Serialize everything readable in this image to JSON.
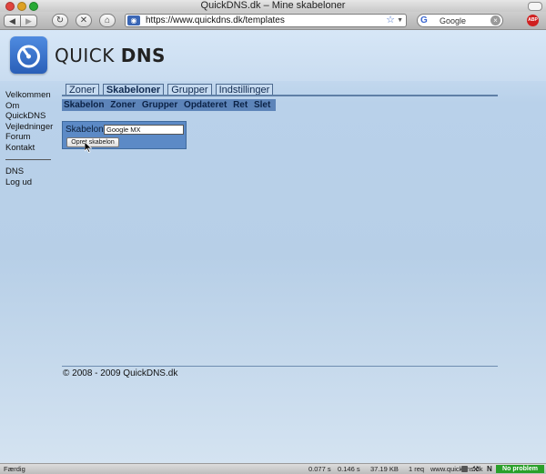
{
  "window": {
    "title": "QuickDNS.dk – Mine skabeloner"
  },
  "toolbar": {
    "back_glyph": "◀",
    "forward_glyph": "▶",
    "reload_glyph": "↻",
    "stop_glyph": "✕",
    "home_glyph": "⌂",
    "url": "https://www.quickdns.dk/templates",
    "search_placeholder": "Google",
    "search_value": "Google",
    "adblock_label": "ABP"
  },
  "header": {
    "logo_text_light": "QUICK",
    "logo_text_bold": "DNS"
  },
  "sidebar": {
    "items": [
      {
        "label": "Velkommen"
      },
      {
        "label": "Om QuickDNS"
      },
      {
        "label": "Vejledninger"
      },
      {
        "label": "Forum"
      },
      {
        "label": "Kontakt"
      }
    ],
    "items2": [
      {
        "label": "DNS"
      },
      {
        "label": "Log ud"
      }
    ]
  },
  "tabs": [
    {
      "label": "Zoner",
      "active": false
    },
    {
      "label": "Skabeloner",
      "active": true
    },
    {
      "label": "Grupper",
      "active": false
    },
    {
      "label": "Indstillinger",
      "active": false
    }
  ],
  "columns": [
    "Skabelon",
    "Zoner",
    "Grupper",
    "Opdateret",
    "Ret",
    "Slet"
  ],
  "form": {
    "label": "Skabelon:",
    "input_value": "Google MX",
    "button_label": "Opret skabelon"
  },
  "footer": {
    "copyright": "© 2008 - 2009 QuickDNS.dk"
  },
  "statusbar": {
    "status": "Færdig",
    "time1": "0.077 s",
    "time2": "0.146 s",
    "size": "37.19 KB",
    "requests": "1 req",
    "host": "www.quickdns.dk",
    "badge": "No problem",
    "n_label": "N"
  },
  "colors": {
    "accent": "#5d84b9",
    "ok": "#2aa02a"
  }
}
